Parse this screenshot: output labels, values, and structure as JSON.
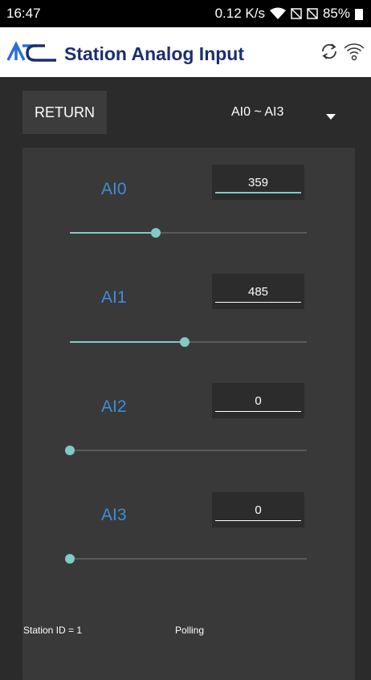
{
  "status_bar": {
    "time": "16:47",
    "speed": "0.12 K/s",
    "battery": "85%"
  },
  "header": {
    "logo_text": "ATC",
    "title": "Station Analog Input",
    "brand_color": "#1b2f6e",
    "accent_color": "#2a6fd6"
  },
  "toolbar": {
    "return_label": "RETURN",
    "range_selected": "AI0 ~ AI3"
  },
  "channels": [
    {
      "label": "AI0",
      "value": "359",
      "level": 0.364,
      "focused": true
    },
    {
      "label": "AI1",
      "value": "485",
      "level": 0.485,
      "focused": false
    },
    {
      "label": "AI2",
      "value": "0",
      "level": 0,
      "focused": false
    },
    {
      "label": "AI3",
      "value": "0",
      "level": 0,
      "focused": false
    }
  ],
  "footer": {
    "station_id": "Station ID = 1",
    "status": "Polling"
  },
  "colors": {
    "label": "#3e8ed8",
    "slider": "#80cbc4"
  }
}
